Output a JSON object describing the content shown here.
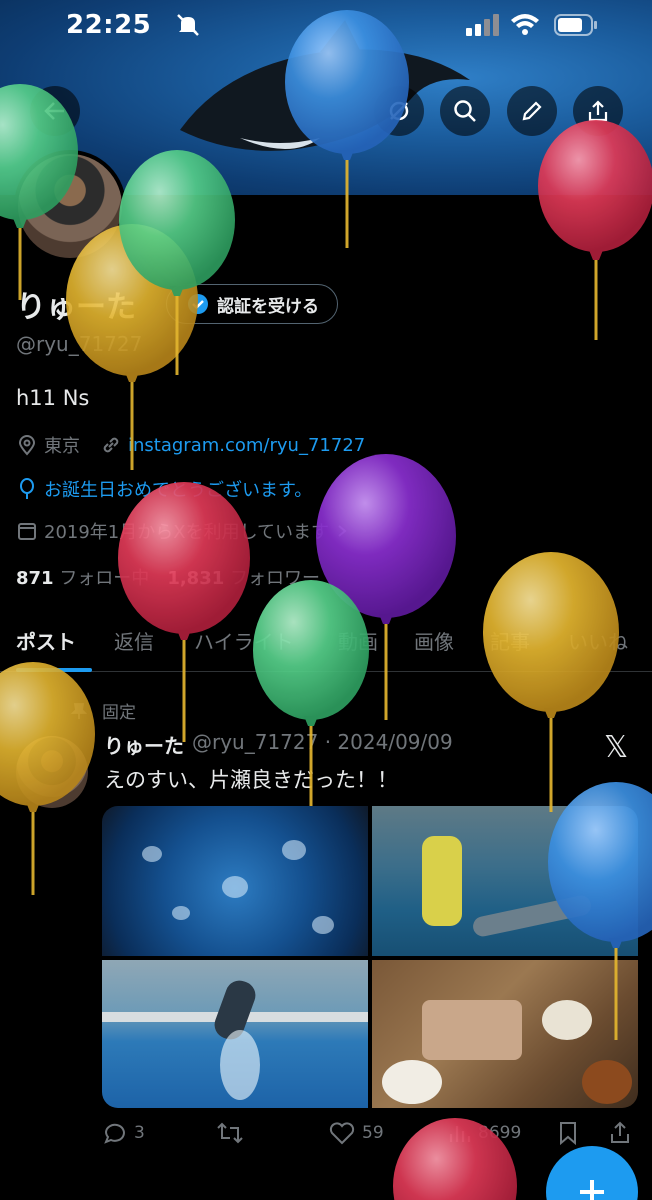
{
  "status_bar": {
    "time": "22:25"
  },
  "profile": {
    "name": "りゅーた",
    "verify_button": "認証を受ける",
    "handle": "@ryu_71727",
    "bio": "h11 Ns",
    "location": "東京",
    "link": "instagram.com/ryu_71727",
    "birthday": "お誕生日おめでとうございます。",
    "joined": "2019年1月からXを利用しています",
    "following_count": "871",
    "following_label": "フォロー中",
    "followers_count": "1,831",
    "followers_label": "フォロワー"
  },
  "tabs": [
    {
      "label": "ポスト"
    },
    {
      "label": "返信"
    },
    {
      "label": "ハイライト"
    },
    {
      "label": "動画"
    },
    {
      "label": "画像"
    },
    {
      "label": "記事"
    },
    {
      "label": "いいね"
    }
  ],
  "post": {
    "pinned_label": "固定",
    "author_name": "りゅーた",
    "author_meta": "@ryu_71727 · 2024/09/09",
    "text": "えのすい、片瀬良きだった！！",
    "replies": "3",
    "likes": "59",
    "views": "8699"
  },
  "icons": {
    "back": "back-arrow-icon",
    "hide": "eye-slash-icon",
    "search": "search-icon",
    "edit": "pencil-icon",
    "share": "share-icon",
    "verify": "verified-badge-icon",
    "location": "location-pin-icon",
    "link": "link-icon",
    "birthday": "balloon-icon",
    "calendar": "calendar-icon",
    "pin": "pin-icon",
    "x_logo": "x-logo-icon",
    "compose": "plus-icon"
  },
  "colors": {
    "accent": "#1d9bf0",
    "background": "#000000",
    "text_primary": "#e7e9ea",
    "text_secondary": "#71767b",
    "balloon_blue": "#3b8fe0",
    "balloon_green": "#56d08a",
    "balloon_yellow": "#e3b52f",
    "balloon_red": "#e03a57",
    "balloon_purple": "#8a2fd0"
  }
}
